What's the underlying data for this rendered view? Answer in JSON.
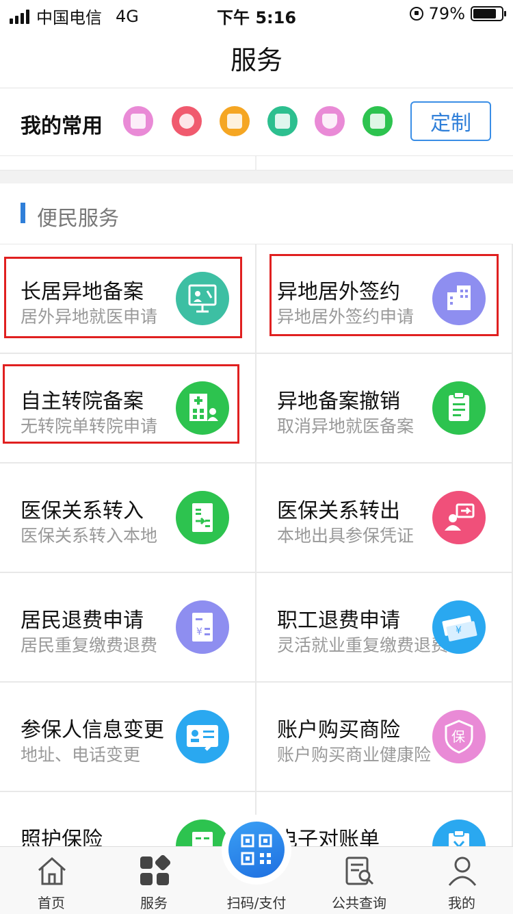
{
  "status": {
    "carrier": "中国电信",
    "network": "4G",
    "time": "下午 5:16",
    "battery": "79%"
  },
  "header": {
    "title": "服务"
  },
  "favorites": {
    "label": "我的常用",
    "customize_label": "定制",
    "icons": [
      {
        "name": "calendar-icon",
        "color": "#e98ad6"
      },
      {
        "name": "medical-cross-icon",
        "color": "#f05a6e"
      },
      {
        "name": "receipt-icon",
        "color": "#f5a623"
      },
      {
        "name": "document-edit-icon",
        "color": "#2dbf8f"
      },
      {
        "name": "insurance-shield-icon",
        "color": "#e98ad6"
      },
      {
        "name": "hospital-transfer-icon",
        "color": "#2dc34f"
      }
    ]
  },
  "section": {
    "title": "便民服务"
  },
  "services": [
    {
      "title": "长居异地备案",
      "subtitle": "居外异地就医申请",
      "icon": "presentation-icon",
      "color": "#3dbfa3",
      "highlighted": true
    },
    {
      "title": "异地居外签约",
      "subtitle": "异地居外签约申请",
      "icon": "building-icon",
      "color": "#8e8ef0",
      "highlighted": true
    },
    {
      "title": "自主转院备案",
      "subtitle": "无转院单转院申请",
      "icon": "hospital-transfer-icon",
      "color": "#2dc34f",
      "highlighted": true
    },
    {
      "title": "异地备案撤销",
      "subtitle": "取消异地就医备案",
      "icon": "clipboard-icon",
      "color": "#2dc34f",
      "highlighted": false
    },
    {
      "title": "医保关系转入",
      "subtitle": "医保关系转入本地",
      "icon": "transfer-in-icon",
      "color": "#2dc34f",
      "highlighted": false
    },
    {
      "title": "医保关系转出",
      "subtitle": "本地出具参保凭证",
      "icon": "transfer-out-icon",
      "color": "#f0507a",
      "highlighted": false
    },
    {
      "title": "居民退费申请",
      "subtitle": "居民重复缴费退费",
      "icon": "refund-doc-icon",
      "color": "#8e8ef0",
      "highlighted": false
    },
    {
      "title": "职工退费申请",
      "subtitle": "灵活就业重复缴费退费",
      "icon": "banknote-icon",
      "color": "#2aa8f0",
      "highlighted": false
    },
    {
      "title": "参保人信息变更",
      "subtitle": "地址、电话变更",
      "icon": "id-card-edit-icon",
      "color": "#2aa8f0",
      "highlighted": false
    },
    {
      "title": "账户购买商险",
      "subtitle": "账户购买商业健康险",
      "icon": "insurance-shield-icon",
      "color": "#e98ad6",
      "highlighted": false
    },
    {
      "title": "照护保险",
      "subtitle": "",
      "icon": "care-doc-icon",
      "color": "#2dc34f",
      "highlighted": false
    },
    {
      "title": "电子对账单",
      "subtitle": "",
      "icon": "statement-icon",
      "color": "#2aa8f0",
      "highlighted": false
    }
  ],
  "tabbar": {
    "items": [
      {
        "label": "首页",
        "icon": "home-icon"
      },
      {
        "label": "服务",
        "icon": "grid-icon"
      },
      {
        "label": "扫码/支付",
        "icon": "qr-code-icon"
      },
      {
        "label": "公共查询",
        "icon": "search-doc-icon"
      },
      {
        "label": "我的",
        "icon": "user-icon"
      }
    ]
  }
}
